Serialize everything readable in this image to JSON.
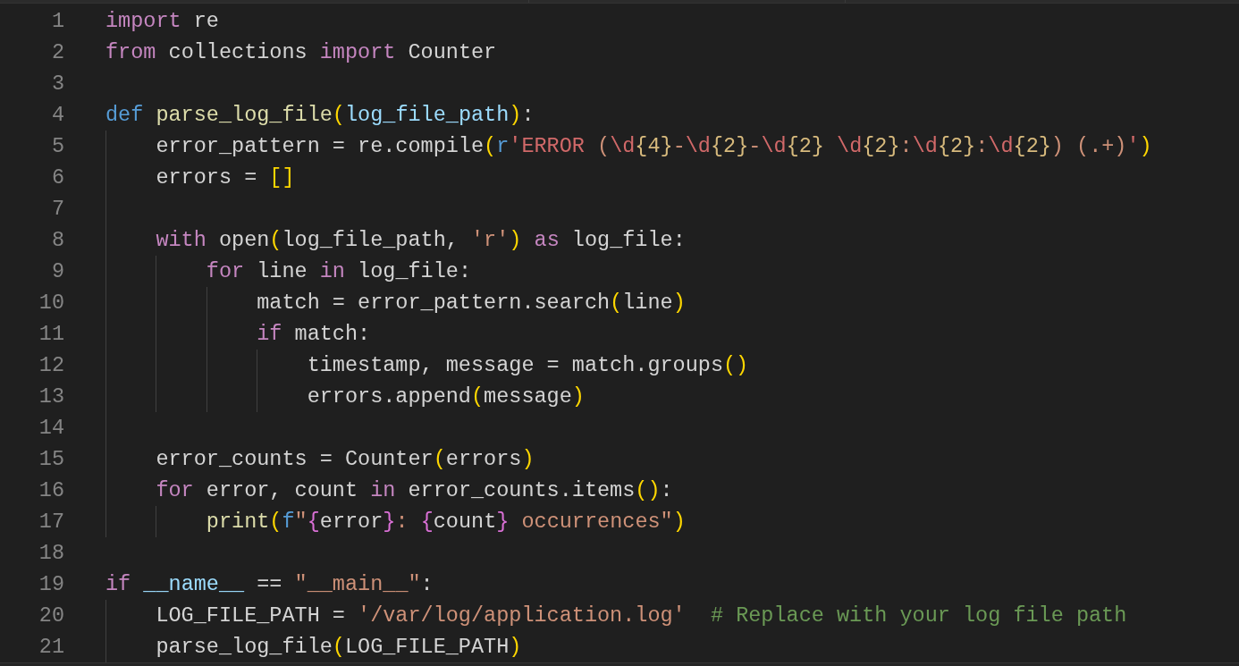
{
  "editor": {
    "lines": [
      {
        "number": "1",
        "tokens": [
          {
            "kind": "kw",
            "text": "import"
          },
          {
            "kind": "plain",
            "text": " re"
          }
        ]
      },
      {
        "number": "2",
        "tokens": [
          {
            "kind": "kw",
            "text": "from"
          },
          {
            "kind": "plain",
            "text": " collections "
          },
          {
            "kind": "kw",
            "text": "import"
          },
          {
            "kind": "plain",
            "text": " Counter"
          }
        ]
      },
      {
        "number": "3"
      },
      {
        "number": "4",
        "tokens": [
          {
            "kind": "storage",
            "text": "def"
          },
          {
            "kind": "fn",
            "text": " parse_log_file"
          },
          {
            "kind": "bracket1",
            "text": "("
          },
          {
            "kind": "param",
            "text": "log_file_path"
          },
          {
            "kind": "bracket1",
            "text": ")"
          },
          {
            "kind": "plain",
            "text": ":"
          }
        ]
      },
      {
        "number": "5",
        "tokens": [
          {
            "kind": "plain",
            "text": "    error_pattern = re.compile"
          },
          {
            "kind": "bracket1",
            "text": "("
          },
          {
            "kind": "storage",
            "text": "r"
          },
          {
            "kind": "regex",
            "text": "'ERROR "
          },
          {
            "kind": "str",
            "text": "("
          },
          {
            "kind": "regex",
            "text": "\\d"
          },
          {
            "kind": "quant",
            "text": "{4}"
          },
          {
            "kind": "str",
            "text": "-"
          },
          {
            "kind": "regex",
            "text": "\\d"
          },
          {
            "kind": "quant",
            "text": "{2}"
          },
          {
            "kind": "str",
            "text": "-"
          },
          {
            "kind": "regex",
            "text": "\\d"
          },
          {
            "kind": "quant",
            "text": "{2}"
          },
          {
            "kind": "regex",
            "text": " \\d"
          },
          {
            "kind": "quant",
            "text": "{2}"
          },
          {
            "kind": "str",
            "text": ":"
          },
          {
            "kind": "regex",
            "text": "\\d"
          },
          {
            "kind": "quant",
            "text": "{2}"
          },
          {
            "kind": "str",
            "text": ":"
          },
          {
            "kind": "regex",
            "text": "\\d"
          },
          {
            "kind": "quant",
            "text": "{2}"
          },
          {
            "kind": "str",
            "text": ") (.+)"
          },
          {
            "kind": "regex",
            "text": "'"
          },
          {
            "kind": "bracket1",
            "text": ")"
          }
        ]
      },
      {
        "number": "6",
        "tokens": [
          {
            "kind": "plain",
            "text": "    errors = "
          },
          {
            "kind": "bracket1",
            "text": "[]"
          }
        ]
      },
      {
        "number": "7"
      },
      {
        "number": "8",
        "tokens": [
          {
            "kind": "kw",
            "text": "    with"
          },
          {
            "kind": "plain",
            "text": " open"
          },
          {
            "kind": "bracket1",
            "text": "("
          },
          {
            "kind": "plain",
            "text": "log_file_path, "
          },
          {
            "kind": "str",
            "text": "'r'"
          },
          {
            "kind": "bracket1",
            "text": ")"
          },
          {
            "kind": "kw",
            "text": " as"
          },
          {
            "kind": "plain",
            "text": " log_file:"
          }
        ]
      },
      {
        "number": "9",
        "tokens": [
          {
            "kind": "kw",
            "text": "        for"
          },
          {
            "kind": "plain",
            "text": " line "
          },
          {
            "kind": "kw",
            "text": "in"
          },
          {
            "kind": "plain",
            "text": " log_file:"
          }
        ]
      },
      {
        "number": "10",
        "tokens": [
          {
            "kind": "plain",
            "text": "            match = error_pattern.search"
          },
          {
            "kind": "bracket1",
            "text": "("
          },
          {
            "kind": "plain",
            "text": "line"
          },
          {
            "kind": "bracket1",
            "text": ")"
          }
        ]
      },
      {
        "number": "11",
        "tokens": [
          {
            "kind": "kw",
            "text": "            if"
          },
          {
            "kind": "plain",
            "text": " match:"
          }
        ]
      },
      {
        "number": "12",
        "tokens": [
          {
            "kind": "plain",
            "text": "                timestamp, message = match.groups"
          },
          {
            "kind": "bracket1",
            "text": "()"
          }
        ]
      },
      {
        "number": "13",
        "tokens": [
          {
            "kind": "plain",
            "text": "                errors.append"
          },
          {
            "kind": "bracket1",
            "text": "("
          },
          {
            "kind": "plain",
            "text": "message"
          },
          {
            "kind": "bracket1",
            "text": ")"
          }
        ]
      },
      {
        "number": "14"
      },
      {
        "number": "15",
        "tokens": [
          {
            "kind": "plain",
            "text": "    error_counts = Counter"
          },
          {
            "kind": "bracket1",
            "text": "("
          },
          {
            "kind": "plain",
            "text": "errors"
          },
          {
            "kind": "bracket1",
            "text": ")"
          }
        ]
      },
      {
        "number": "16",
        "tokens": [
          {
            "kind": "kw",
            "text": "    for"
          },
          {
            "kind": "plain",
            "text": " error, count "
          },
          {
            "kind": "kw",
            "text": "in"
          },
          {
            "kind": "plain",
            "text": " error_counts.items"
          },
          {
            "kind": "bracket1",
            "text": "()"
          },
          {
            "kind": "plain",
            "text": ":"
          }
        ]
      },
      {
        "number": "17",
        "tokens": [
          {
            "kind": "fn",
            "text": "        print"
          },
          {
            "kind": "bracket1",
            "text": "("
          },
          {
            "kind": "storage",
            "text": "f"
          },
          {
            "kind": "str",
            "text": "\""
          },
          {
            "kind": "bracket2",
            "text": "{"
          },
          {
            "kind": "plain",
            "text": "error"
          },
          {
            "kind": "bracket2",
            "text": "}"
          },
          {
            "kind": "str",
            "text": ": "
          },
          {
            "kind": "bracket2",
            "text": "{"
          },
          {
            "kind": "plain",
            "text": "count"
          },
          {
            "kind": "bracket2",
            "text": "}"
          },
          {
            "kind": "str",
            "text": " occurrences\""
          },
          {
            "kind": "bracket1",
            "text": ")"
          }
        ]
      },
      {
        "number": "18"
      },
      {
        "number": "19",
        "tokens": [
          {
            "kind": "kw",
            "text": "if"
          },
          {
            "kind": "var",
            "text": " __name__"
          },
          {
            "kind": "plain",
            "text": " == "
          },
          {
            "kind": "str",
            "text": "\"__main__\""
          },
          {
            "kind": "plain",
            "text": ":"
          }
        ]
      },
      {
        "number": "20",
        "tokens": [
          {
            "kind": "plain",
            "text": "    LOG_FILE_PATH = "
          },
          {
            "kind": "str",
            "text": "'/var/log/application.log'"
          },
          {
            "kind": "comment",
            "text": "  # Replace with your log file path"
          }
        ]
      },
      {
        "number": "21",
        "tokens": [
          {
            "kind": "plain",
            "text": "    parse_log_file"
          },
          {
            "kind": "bracket1",
            "text": "("
          },
          {
            "kind": "plain",
            "text": "LOG_FILE_PATH"
          },
          {
            "kind": "bracket1",
            "text": ")"
          }
        ]
      }
    ]
  }
}
